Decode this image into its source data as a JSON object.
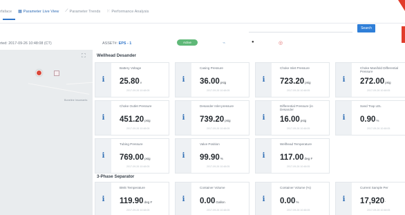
{
  "tabs": [
    {
      "label": "rfaface",
      "icon": ""
    },
    {
      "label": "Parameter Live View",
      "icon": "grid-icon"
    },
    {
      "label": "Parameter Trends",
      "icon": "trend-icon"
    },
    {
      "label": "Performance Analysis",
      "icon": "scatter-icon"
    }
  ],
  "search": {
    "placeholder": "",
    "button_label": "Search"
  },
  "status": {
    "updated": "rted: 2017-09-26 10:48:08 (CT)",
    "asset_prefix": "ASSET#:",
    "asset_name": "EPS - 1",
    "badge": "Active"
  },
  "map": {
    "place_label": "Boneline Insumants"
  },
  "sections": [
    {
      "title": "Wellhead Desander",
      "cards": [
        {
          "label": "Battery Voltage",
          "value": "25.80",
          "unit": "v"
        },
        {
          "label": "Casing Pressure",
          "value": "36.00",
          "unit": "psig"
        },
        {
          "label": "Choke Inlet Pressure",
          "value": "723.20",
          "unit": "psig"
        },
        {
          "label": "Choke Manifold Differential\nPressure",
          "value": "272.00",
          "unit": "psig"
        },
        {
          "label": "Choke Outlet Pressure",
          "value": "451.20",
          "unit": "psig"
        },
        {
          "label": "Desander Inlet pressure",
          "value": "739.20",
          "unit": "psig"
        },
        {
          "label": "Differential Pressure (in\nDesander",
          "value": "16.00",
          "unit": "psig"
        },
        {
          "label": "Sand Trap LEL",
          "value": "0.90",
          "unit": "%"
        },
        {
          "label": "Tubing Pressure",
          "value": "769.00",
          "unit": "psig"
        },
        {
          "label": "Valve Position",
          "value": "99.90",
          "unit": "%"
        },
        {
          "label": "Wellhead Temperature",
          "value": "117.00",
          "unit": "deg F"
        }
      ]
    },
    {
      "title": "3-Phase Separator",
      "cards": [
        {
          "label": "BMS Temperature",
          "value": "119.90",
          "unit": "deg F"
        },
        {
          "label": "Container Volume",
          "value": "0.00",
          "unit": "Gallon"
        },
        {
          "label": "Container Volume (%)",
          "value": "0.00",
          "unit": "%"
        },
        {
          "label": "Current Sample Per",
          "value": "17,920",
          "unit": "'"
        }
      ]
    }
  ],
  "card_timestamp": "2017-09-26 10:48:05",
  "colors": {
    "accent": "#2e74c9",
    "icon": "#2e6db4",
    "badge": "#5fb878",
    "alert": "#e13c2b"
  }
}
